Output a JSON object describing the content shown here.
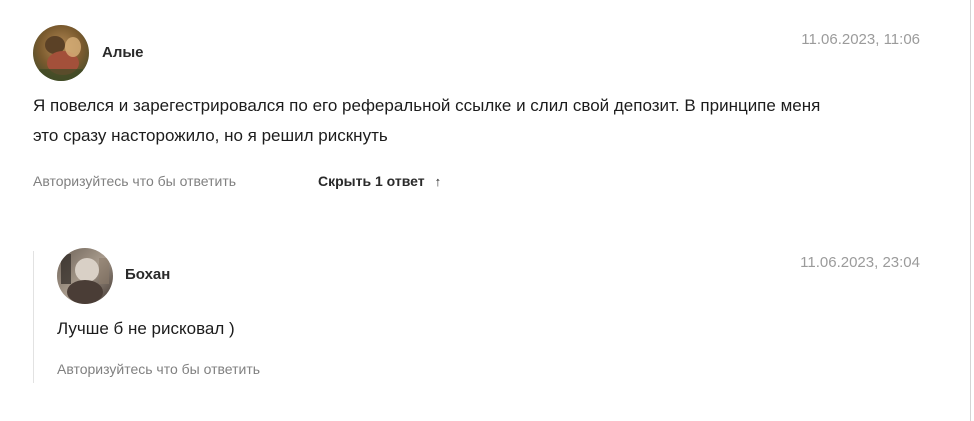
{
  "comments": [
    {
      "author": "Алые",
      "date": "11.06.2023, 11:06",
      "text_line1": "Я повелся и зарегестрировался по его реферальной ссылке и слил свой депозит. В принципе меня",
      "text_line2": "это сразу насторожило, но я решил рискнуть",
      "reply_label": "Авторизуйтесь что бы ответить",
      "toggle_label": "Скрыть 1 ответ",
      "toggle_icon": "arrow-up-icon"
    }
  ],
  "replies": [
    {
      "author": "Бохан",
      "date": "11.06.2023, 23:04",
      "text": "Лучше б не рисковал )",
      "reply_label": "Авторизуйтесь что бы ответить"
    }
  ],
  "colors": {
    "date": "#9b9b9b",
    "secondary_text": "#808080",
    "thread_line": "#e2e2e2"
  }
}
